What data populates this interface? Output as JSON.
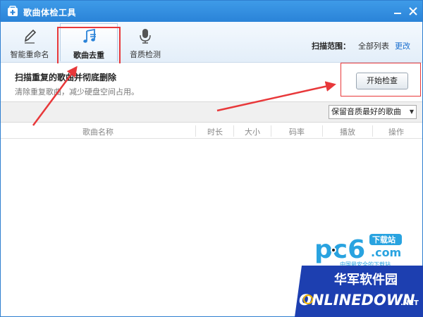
{
  "window": {
    "title": "歌曲体检工具"
  },
  "toolbar": {
    "tools": [
      {
        "label": "智能重命名",
        "icon": "pencil-icon"
      },
      {
        "label": "歌曲去重",
        "icon": "music-note-icon",
        "active": true
      },
      {
        "label": "音质检测",
        "icon": "microphone-icon"
      }
    ],
    "scan_label": "扫描范围：",
    "scan_value": "全部列表",
    "change_link": "更改"
  },
  "info": {
    "title": "扫描重复的歌曲并彻底删除",
    "description": "清除重复歌曲，减少硬盘空间占用。",
    "start_button": "开始检查"
  },
  "filter": {
    "selected": "保留音质最好的歌曲"
  },
  "table": {
    "columns": [
      "歌曲名称",
      "时长",
      "大小",
      "码率",
      "播放",
      "操作"
    ]
  },
  "watermarks": {
    "pc6_text": "pc6",
    "pc6_badge": "下载站",
    "pc6_domain": ".com",
    "pc6_tagline": "中国最安全的下载站",
    "onlinedown_cn": "华军软件园",
    "onlinedown_en": "ONLINEDOWN",
    "onlinedown_suffix": ".NET"
  },
  "colors": {
    "titlebar": "#2a83d8",
    "highlight_red": "#e8383a",
    "link_blue": "#1a6fcf"
  }
}
